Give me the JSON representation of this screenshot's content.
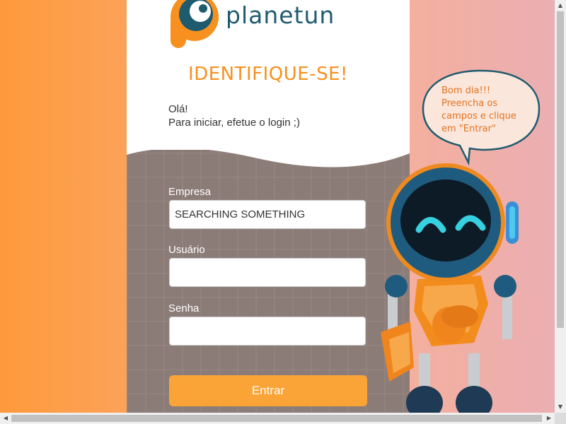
{
  "brand": {
    "logo_icon": "planetun-p-logo-icon",
    "name": "planetun",
    "primary_color": "#1f5b6e",
    "accent_color": "#f7901e"
  },
  "login": {
    "title": "IDENTIFIQUE-SE!",
    "greeting": "Olá!",
    "instruction": "Para iniciar, efetue o login ;)",
    "company_label": "Empresa",
    "company_value": "SEARCHING SOMETHING",
    "user_label": "Usuário",
    "user_value": "",
    "password_label": "Senha",
    "password_value": "",
    "submit_label": "Entrar",
    "button_color": "#faa437"
  },
  "mascot": {
    "icon": "robot-mascot-icon",
    "speech_line1": "Bom dia!!!",
    "speech_line2": "Preencha os",
    "speech_line3": "campos e clique",
    "speech_line4": "em \"Entrar\""
  },
  "scrollbars": {
    "vertical_up_icon": "scroll-up-arrow-icon",
    "vertical_down_icon": "scroll-down-arrow-icon",
    "horizontal_left_icon": "scroll-left-arrow-icon",
    "horizontal_right_icon": "scroll-right-arrow-icon"
  }
}
